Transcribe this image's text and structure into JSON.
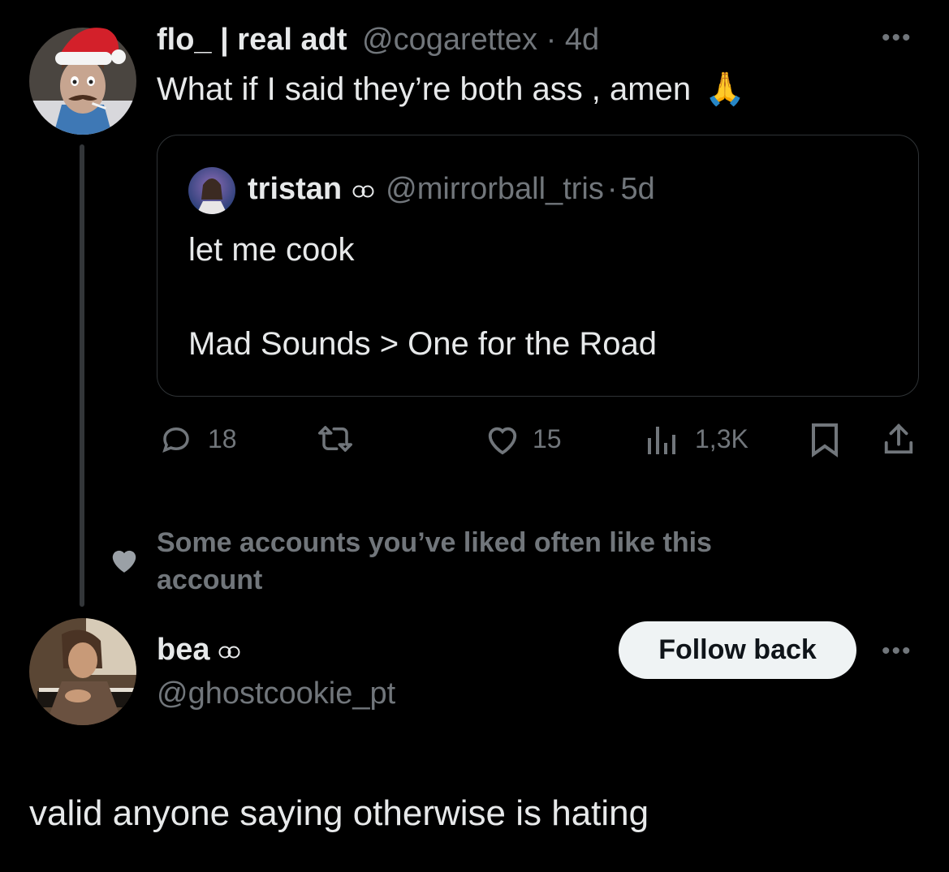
{
  "tweet": {
    "author_name": "flo_ | real adt",
    "handle": "@cogarettex",
    "separator": "·",
    "time": "4d",
    "text": "What if I said they’re both ass , amen",
    "emoji": "🙏",
    "more_icon": "more-dots-icon"
  },
  "quoted": {
    "author_name": "tristan",
    "badge_icon": "infinity-icon",
    "handle": "@mirrorball_tris",
    "separator": "·",
    "time": "5d",
    "line1": "let me cook",
    "line2": "Mad Sounds > One for the Road"
  },
  "actions": {
    "replies": "18",
    "likes": "15",
    "views": "1,3K"
  },
  "social_context": {
    "text": "Some accounts you’ve liked often like this account",
    "icon": "heart-icon"
  },
  "suggested": {
    "name": "bea",
    "badge_icon": "infinity-icon",
    "handle": "@ghostcookie_pt",
    "button": "Follow back"
  },
  "reply": {
    "text": "valid anyone saying otherwise is hating"
  },
  "colors": {
    "background": "#000000",
    "text": "#e7e9ea",
    "muted": "#71767b",
    "border": "#2f3336",
    "button_bg": "#eff3f4"
  }
}
